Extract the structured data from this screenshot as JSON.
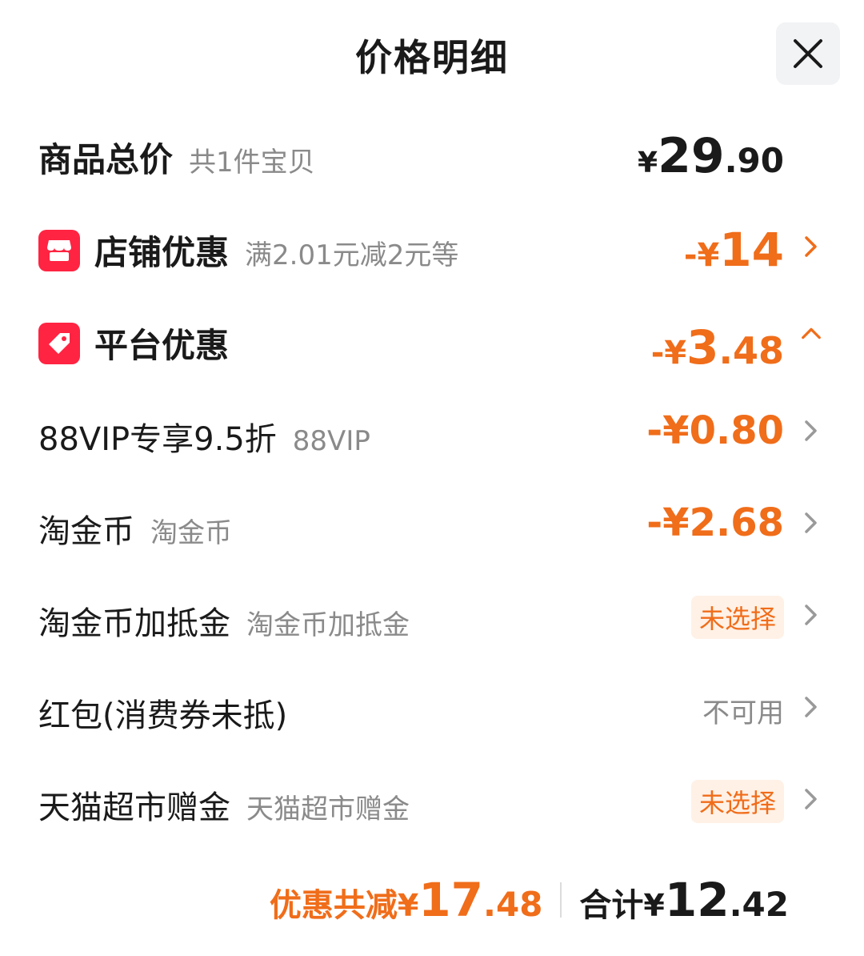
{
  "header": {
    "title": "价格明细"
  },
  "total": {
    "label": "商品总价",
    "sub": "共1件宝贝",
    "currency": "¥",
    "int": "29",
    "dec": ".90"
  },
  "shop": {
    "label": "店铺优惠",
    "sub": "满2.01元减2元等",
    "prefix": "-¥",
    "int": "14"
  },
  "platform": {
    "label": "平台优惠",
    "prefix": "-¥",
    "int": "3",
    "dec": ".48"
  },
  "items": [
    {
      "label": "88VIP专享9.5折",
      "sub": "88VIP",
      "value": "-¥0.80"
    },
    {
      "label": "淘金币",
      "sub": "淘金币",
      "value": "-¥2.68"
    },
    {
      "label": "淘金币加抵金",
      "sub": "淘金币加抵金",
      "value": "未选择"
    },
    {
      "label": "红包(消费券未抵)",
      "sub": "",
      "value": "不可用"
    },
    {
      "label": "天猫超市赠金",
      "sub": "天猫超市赠金",
      "value": "未选择"
    }
  ],
  "footer": {
    "discount_label": "优惠共减",
    "discount_currency": "¥",
    "discount_int": "17",
    "discount_dec": ".48",
    "sum_label": "合计",
    "sum_currency": "¥",
    "sum_int": "12",
    "sum_dec": ".42"
  },
  "colors": {
    "accent": "#f06d1a",
    "badge": "#ff2442"
  }
}
